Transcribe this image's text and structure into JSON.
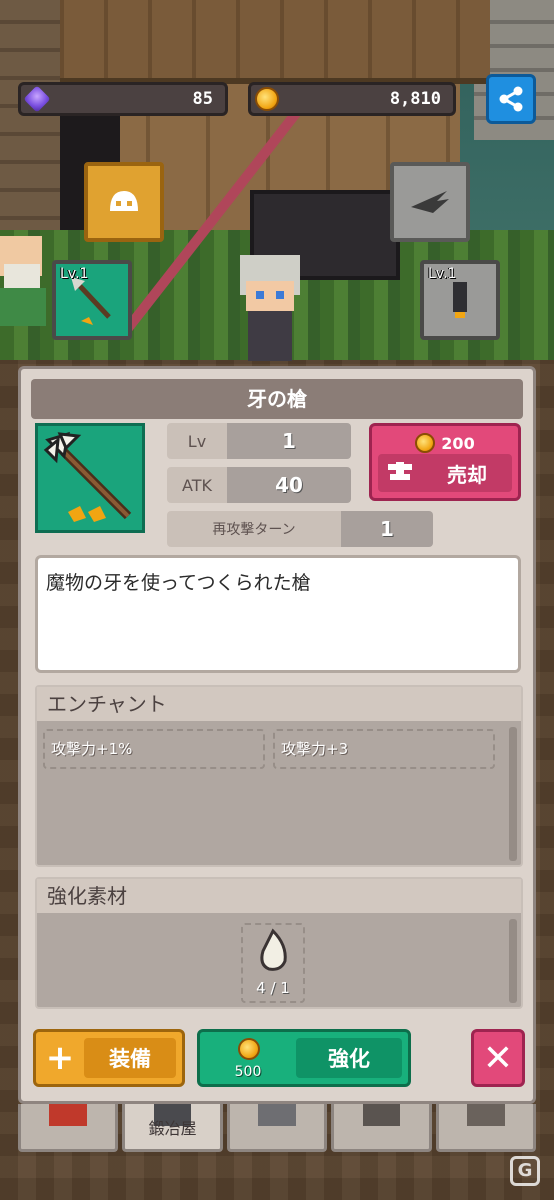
{
  "hud": {
    "gems": "85",
    "coins": "8,810"
  },
  "scene": {
    "slots": [
      {
        "name": "helmet",
        "level": ""
      },
      {
        "name": "wing",
        "level": ""
      },
      {
        "name": "weapon",
        "level": "Lv.1"
      },
      {
        "name": "armor",
        "level": "Lv.1"
      }
    ]
  },
  "item": {
    "name": "牙の槍",
    "stats": {
      "lv_label": "Lv",
      "lv_value": "1",
      "atk_label": "ATK",
      "atk_value": "40",
      "turn_label": "再攻撃ターン",
      "turn_value": "1"
    },
    "sell": {
      "price": "200",
      "label": "売却"
    },
    "description": "魔物の牙を使ってつくられた槍"
  },
  "enchant": {
    "heading": "エンチャント",
    "items": [
      "攻撃力+1%",
      "攻撃力+3"
    ]
  },
  "materials": {
    "heading": "強化素材",
    "count": "4 / 1"
  },
  "actions": {
    "equip_label": "装備",
    "enhance_cost": "500",
    "enhance_label": "強化"
  },
  "nav": {
    "tabs": [
      "",
      "鍛冶屋",
      "",
      "",
      ""
    ]
  },
  "colors": {
    "sell": "#e2497a",
    "equip": "#f0a82c",
    "enhance": "#18b07c",
    "item_bg": "#1aa47c"
  }
}
